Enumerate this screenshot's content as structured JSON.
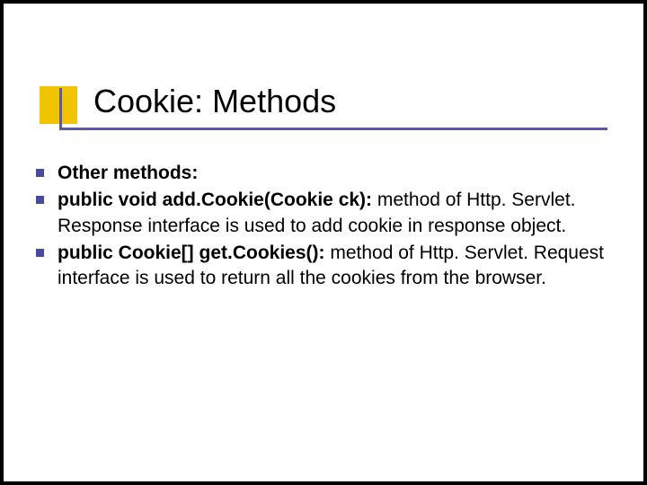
{
  "title": "Cookie: Methods",
  "bullets": [
    {
      "bold": "Other methods:",
      "rest": ""
    },
    {
      "bold": "public void add.Cookie(Cookie ck):",
      "rest": " method of Http. Servlet. Response interface is used to add cookie in response object."
    },
    {
      "bold": "public Cookie[] get.Cookies():",
      "rest": " method of Http. Servlet. Request interface is used to return all the cookies from the browser."
    }
  ]
}
